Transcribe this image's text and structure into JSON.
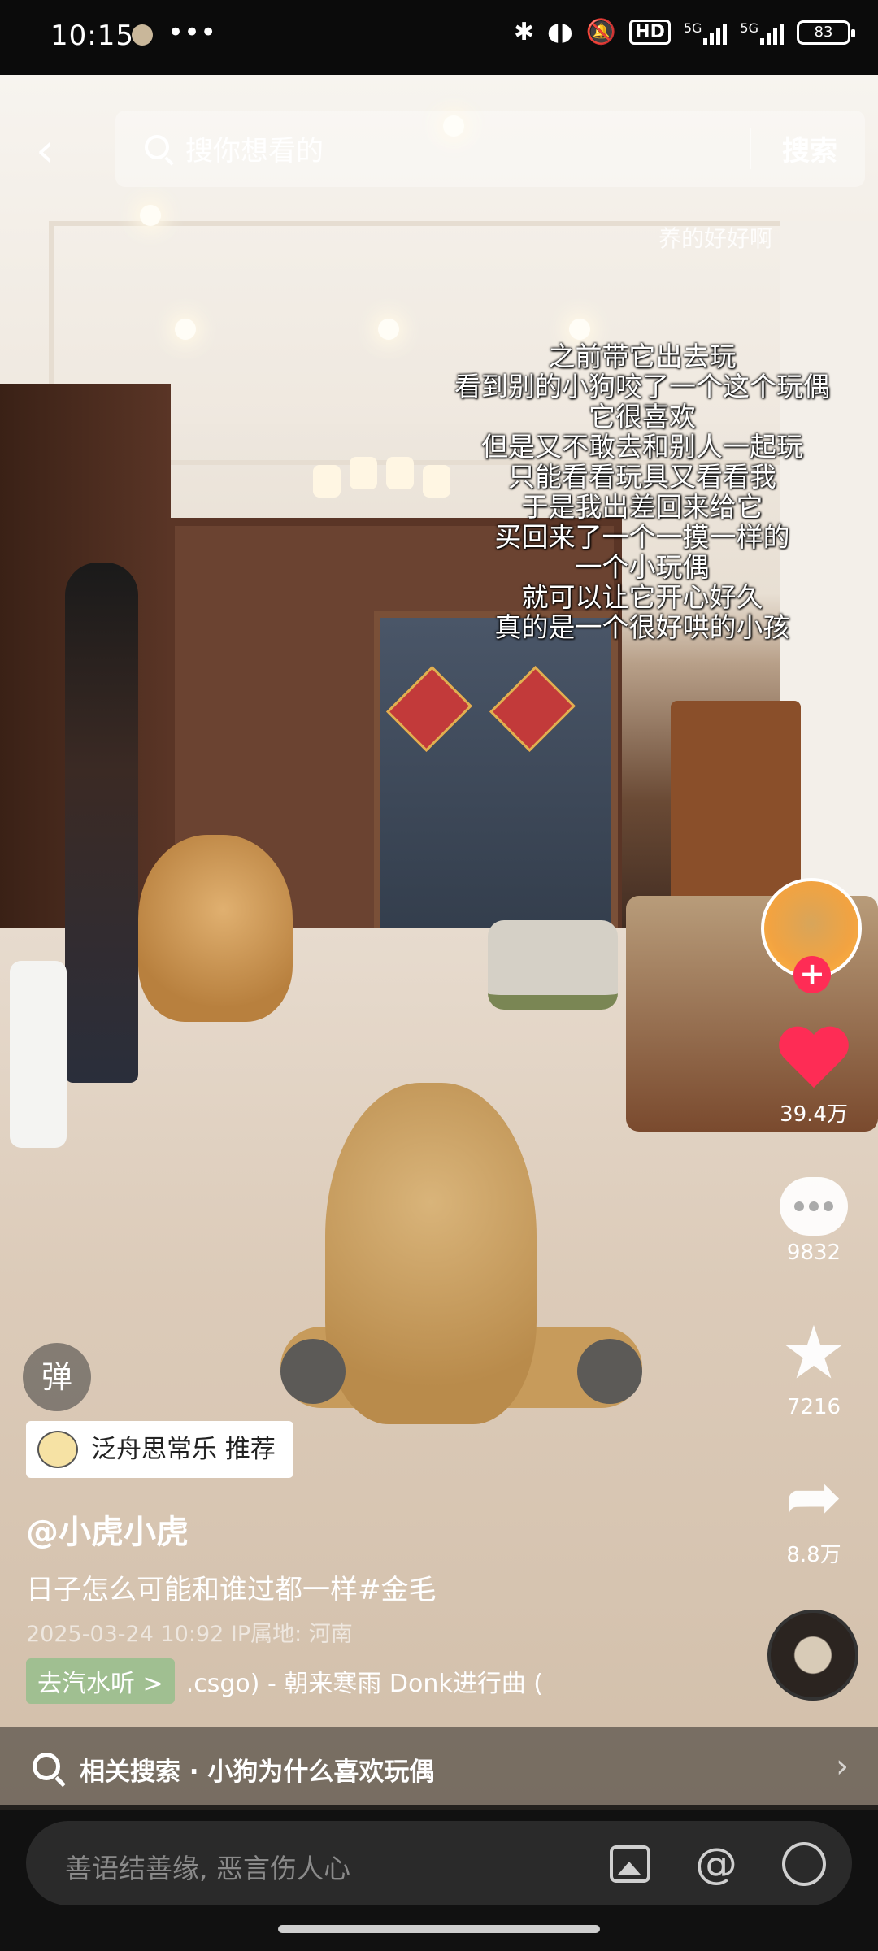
{
  "status_bar": {
    "time": "10:15",
    "more": "•••",
    "bluetooth": "✱",
    "hd": "HD",
    "net1": "5G",
    "net2": "5G",
    "battery": "83"
  },
  "topbar": {
    "search_placeholder": "搜你想看的",
    "search_button": "搜索"
  },
  "video": {
    "watermark": "养的好好啊",
    "caption_lines": [
      "之前带它出去玩",
      "看到别的小狗咬了一个这个玩偶",
      "它很喜欢",
      "但是又不敢去和别人一起玩",
      "只能看看玩具又看看我",
      "于是我出差回来给它",
      "买回来了一个一摸一样的",
      "一个小玩偶",
      "就可以让它开心好久",
      "真的是一个很好哄的小孩"
    ]
  },
  "actions": {
    "follow_symbol": "+",
    "likes": "39.4万",
    "comments": "9832",
    "favorites": "7216",
    "shares": "8.8万"
  },
  "info": {
    "danmu": "弹",
    "recommend": "泛舟思常乐 推荐",
    "author": "@小虎小虎",
    "description": "日子怎么可能和谁过都一样#金毛",
    "meta": "2025-03-24 10:92 IP属地: 河南",
    "music_tag": "去汽水听 >",
    "music_text": ".csgo) - 朝来寒雨    Donk进行曲 ("
  },
  "related": {
    "text": "相关搜索 · 小狗为什么喜欢玩偶",
    "chevron": "›"
  },
  "comment": {
    "placeholder": "善语结善缘, 恶言伤人心"
  },
  "colors": {
    "accent": "#fe2c55",
    "music_tag_bg": "#96be8c"
  }
}
